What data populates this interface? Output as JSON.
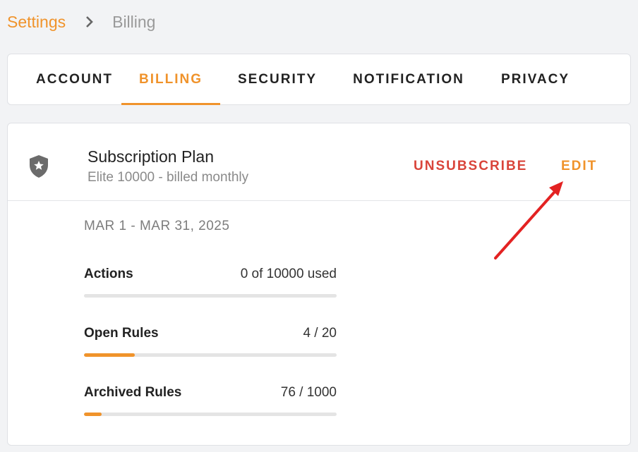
{
  "breadcrumb": {
    "parent": "Settings",
    "current": "Billing"
  },
  "tabs": [
    {
      "label": "ACCOUNT",
      "active": false
    },
    {
      "label": "BILLING",
      "active": true
    },
    {
      "label": "SECURITY",
      "active": false
    },
    {
      "label": "NOTIFICATION",
      "active": false
    },
    {
      "label": "PRIVACY",
      "active": false
    }
  ],
  "plan": {
    "title": "Subscription Plan",
    "subtitle": "Elite 10000 - billed monthly",
    "unsubscribe_label": "UNSUBSCRIBE",
    "edit_label": "EDIT",
    "icon": "shield-star-icon"
  },
  "period": "MAR 1 - MAR 31, 2025",
  "usage": [
    {
      "label": "Actions",
      "value": "0 of 10000 used",
      "fraction": 0.0
    },
    {
      "label": "Open Rules",
      "value": "4 / 20",
      "fraction": 0.2
    },
    {
      "label": "Archived Rules",
      "value": "76 / 1000",
      "fraction": 0.07
    }
  ],
  "colors": {
    "accent": "#f0932b",
    "danger": "#d9443a",
    "arrow": "#e32222"
  }
}
